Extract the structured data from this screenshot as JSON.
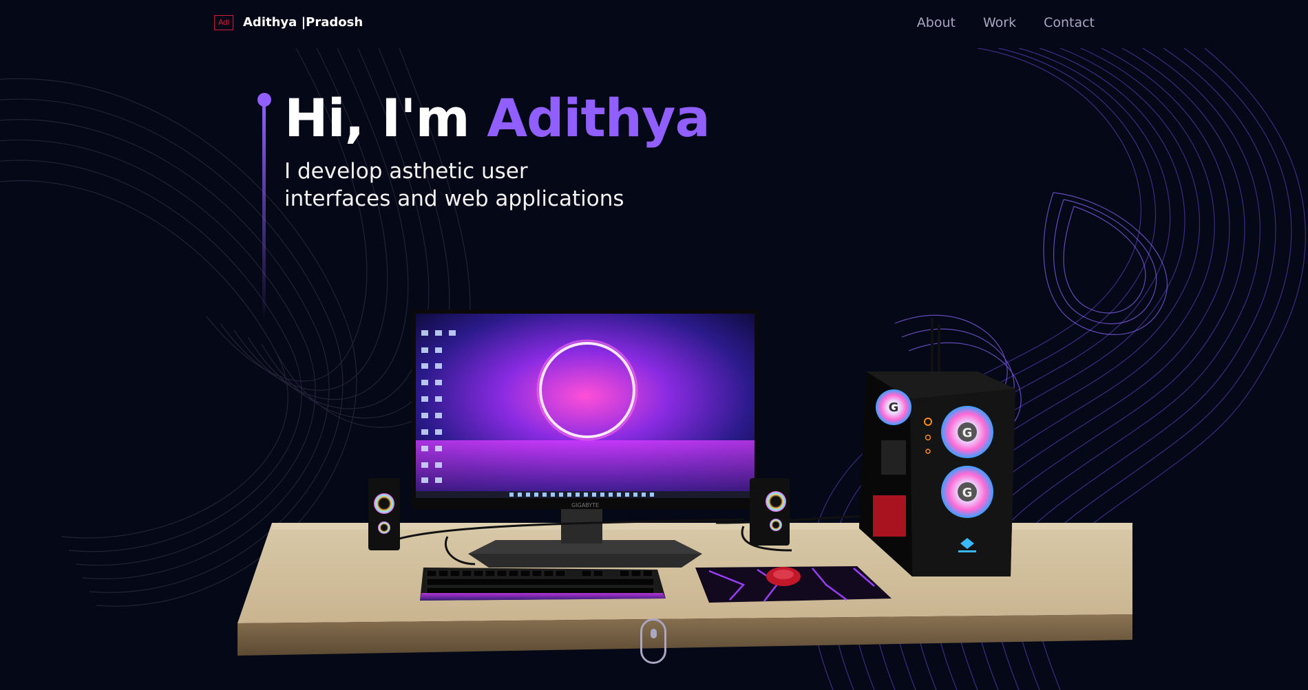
{
  "nav": {
    "logo_text": "Adi",
    "brand_first": "Adithya",
    "brand_last": "Pradosh",
    "links": [
      {
        "label": "About"
      },
      {
        "label": "Work"
      },
      {
        "label": "Contact"
      }
    ]
  },
  "hero": {
    "greeting": "Hi, I'm",
    "name": "Adithya",
    "subtitle_line1": "I develop asthetic user",
    "subtitle_line2": "interfaces and web applications"
  },
  "scene": {
    "monitor_brand": "GIGABYTE",
    "description_icons": [
      "desk",
      "monitor",
      "speaker",
      "keyboard",
      "mouse",
      "mousepad",
      "pc-case"
    ]
  },
  "colors": {
    "background": "#050816",
    "accent": "#915eff",
    "nav_text": "#aaa6c3",
    "logo": "#d11f3a"
  }
}
